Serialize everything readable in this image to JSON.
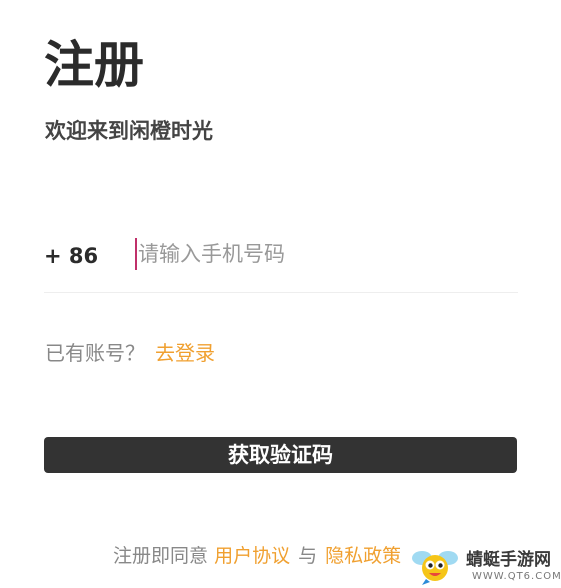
{
  "header": {
    "title": "注册",
    "subtitle": "欢迎来到闲橙时光"
  },
  "phone": {
    "country_code": "+ 86",
    "placeholder": "请输入手机号码",
    "value": ""
  },
  "login": {
    "prompt": "已有账号？",
    "link_label": "去登录"
  },
  "submit": {
    "label": "获取验证码"
  },
  "agreement": {
    "prefix": "注册即同意",
    "user_agreement": "用户协议",
    "and": "与",
    "privacy_policy": "隐私政策"
  },
  "watermark": {
    "name": "蜻蜓手游网",
    "url": "WWW.QT6.COM"
  },
  "colors": {
    "accent": "#f0a030",
    "primary_button": "#333333",
    "cursor": "#c0306a"
  }
}
